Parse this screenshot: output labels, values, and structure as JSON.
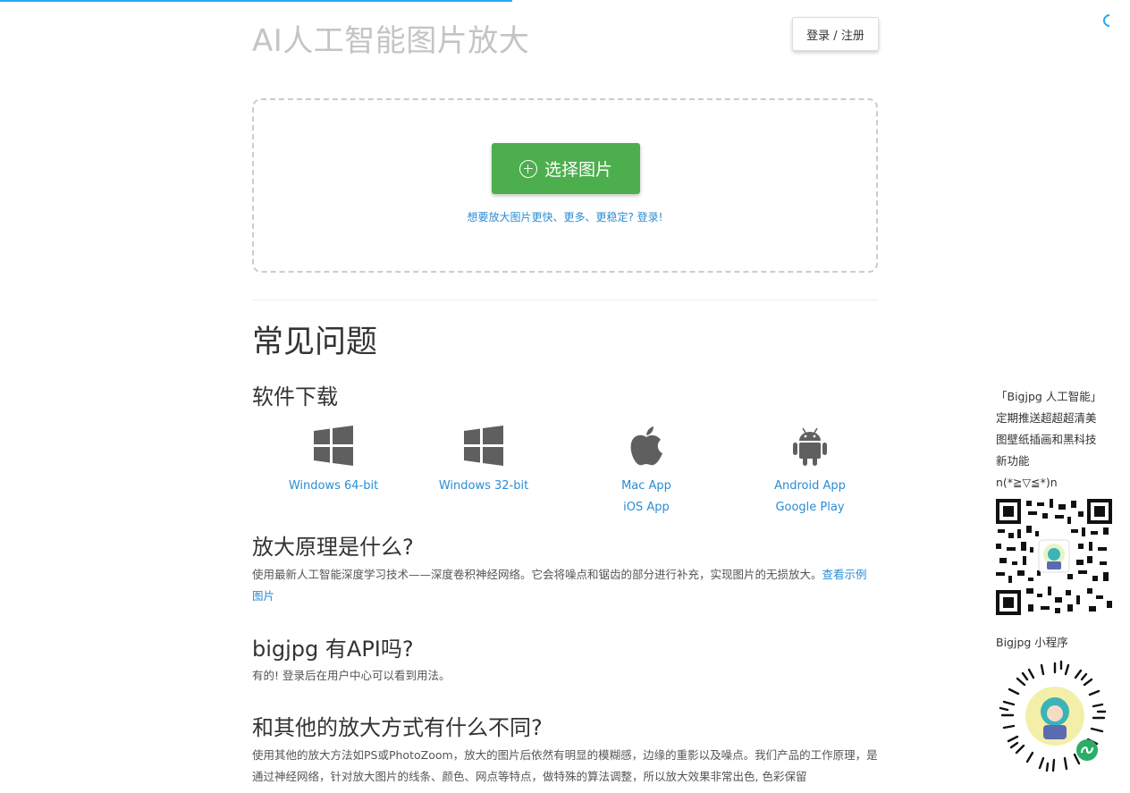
{
  "header": {
    "site_title": "AI人工智能图片放大",
    "login_label": "登录 / 注册"
  },
  "upload": {
    "select_button_label": "选择图片",
    "login_hint": "想要放大图片更快、更多、更稳定? 登录!"
  },
  "faq": {
    "heading": "常见问题",
    "downloads": {
      "heading": "软件下载",
      "items": [
        {
          "icon": "windows-icon",
          "links": [
            "Windows 64-bit"
          ]
        },
        {
          "icon": "windows-icon",
          "links": [
            "Windows 32-bit"
          ]
        },
        {
          "icon": "apple-icon",
          "links": [
            "Mac App",
            "iOS App"
          ]
        },
        {
          "icon": "android-icon",
          "links": [
            "Android App",
            "Google Play"
          ]
        }
      ]
    },
    "principle": {
      "heading": "放大原理是什么?",
      "text": "使用最新人工智能深度学习技术——深度卷积神经网络。它会将噪点和锯齿的部分进行补充，实现图片的无损放大。",
      "link": "查看示例图片"
    },
    "api": {
      "heading": "bigjpg 有API吗?",
      "text": "有的! 登录后在用户中心可以看到用法。"
    },
    "difference": {
      "heading": "和其他的放大方式有什么不同?",
      "text": "使用其他的放大方法如PS或PhotoZoom，放大的图片后依然有明显的模糊感，边缘的重影以及噪点。我们产品的工作原理，是通过神经网络，针对放大图片的线条、颜色、网点等特点，做特殊的算法调整，所以放大效果非常出色, 色彩保留"
    }
  },
  "side": {
    "lines": [
      "「Bigjpg 人工智能」",
      "定期推送超超超清美",
      "图壁纸插画和黑科技",
      "新功能",
      "n(*≧▽≦*)n"
    ],
    "qr_icon": "qr-code-icon",
    "mini_program_label": "Bigjpg 小程序",
    "mini_code_icon": "wechat-mini-program-code-icon"
  },
  "colors": {
    "accent_blue": "#2a8dd4",
    "button_green": "#4cae4c",
    "title_gray": "#c4c4c4"
  }
}
